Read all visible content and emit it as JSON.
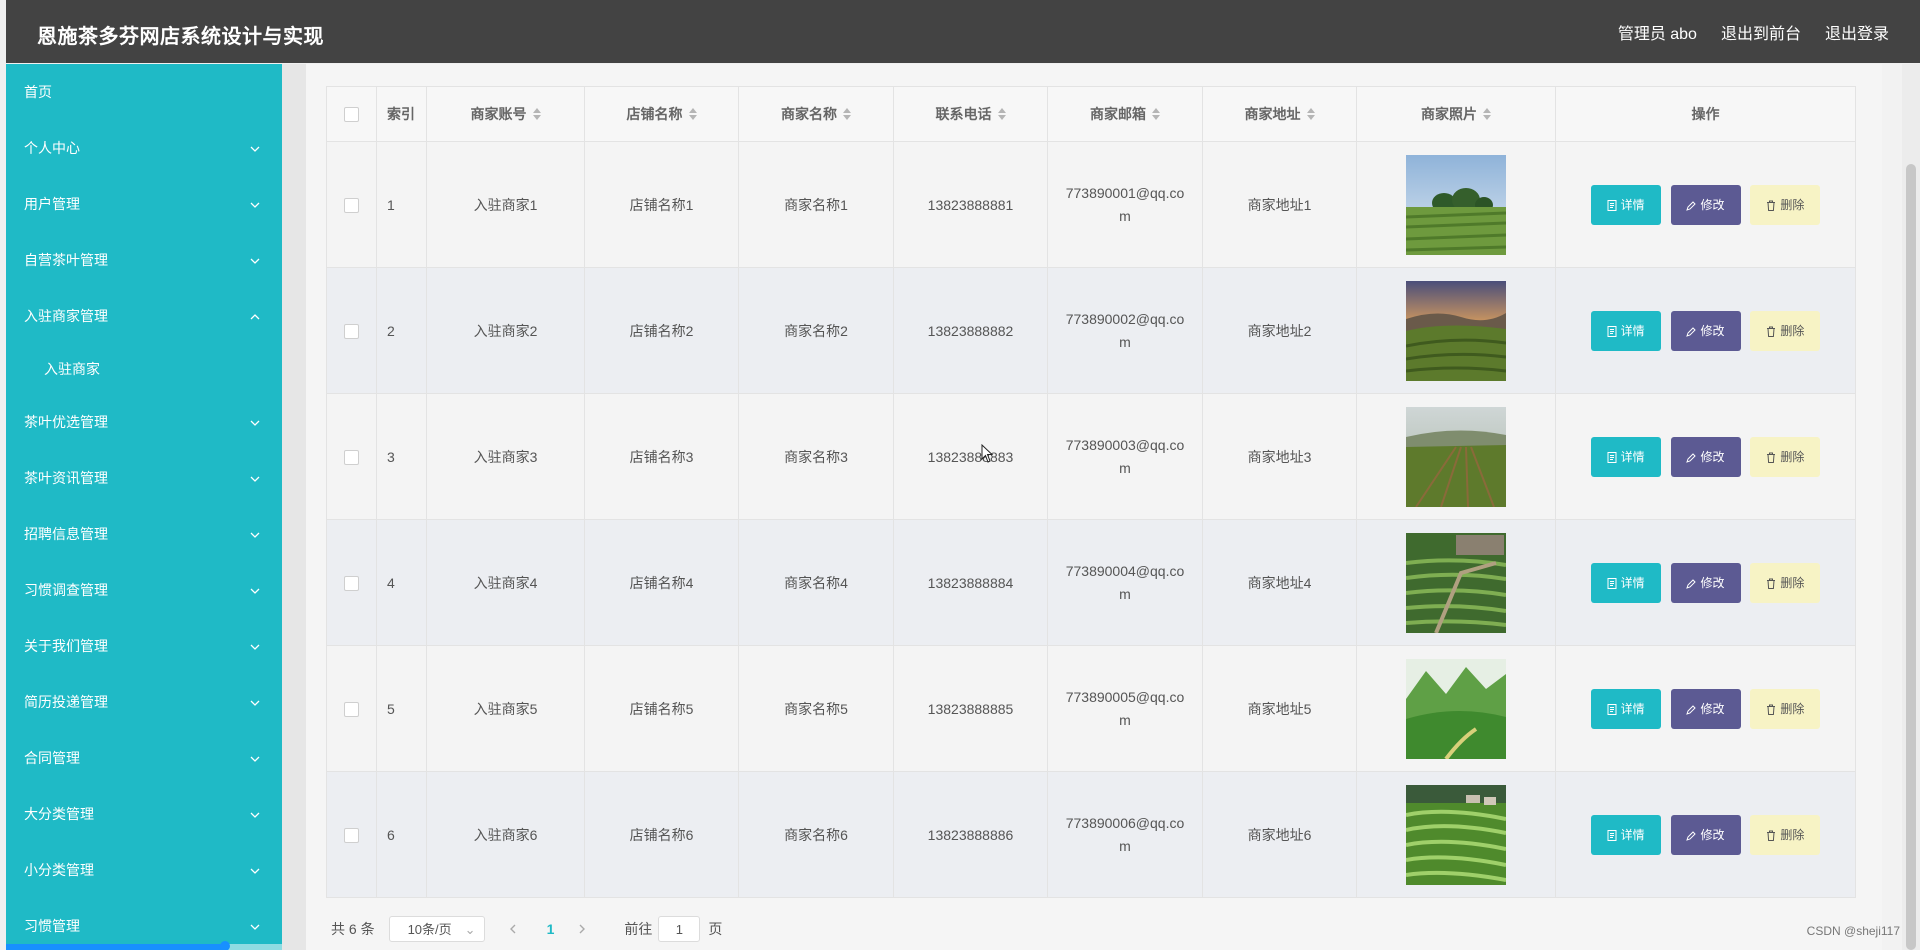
{
  "header": {
    "title": "恩施茶多芬网店系统设计与实现",
    "admin": "管理员 abo",
    "to_front": "退出到前台",
    "logout": "退出登录"
  },
  "sidebar": {
    "home": "首页",
    "items": [
      "个人中心",
      "用户管理",
      "自营茶叶管理",
      "入驻商家管理",
      "茶叶优选管理",
      "茶叶资讯管理",
      "招聘信息管理",
      "习惯调查管理",
      "关于我们管理",
      "简历投递管理",
      "合同管理",
      "大分类管理",
      "小分类管理",
      "习惯管理"
    ],
    "open_submenu": "入驻商家"
  },
  "table": {
    "headers": [
      "索引",
      "商家账号",
      "店铺名称",
      "商家名称",
      "联系电话",
      "商家邮箱",
      "商家地址",
      "商家照片",
      "操作"
    ],
    "rows": [
      {
        "index": "1",
        "account": "入驻商家1",
        "shop": "店铺名称1",
        "name": "商家名称1",
        "phone": "13823888881",
        "email1": "773890001@qq.co",
        "email2": "m",
        "address": "商家地址1"
      },
      {
        "index": "2",
        "account": "入驻商家2",
        "shop": "店铺名称2",
        "name": "商家名称2",
        "phone": "13823888882",
        "email1": "773890002@qq.co",
        "email2": "m",
        "address": "商家地址2"
      },
      {
        "index": "3",
        "account": "入驻商家3",
        "shop": "店铺名称3",
        "name": "商家名称3",
        "phone": "13823888883",
        "email1": "773890003@qq.co",
        "email2": "m",
        "address": "商家地址3"
      },
      {
        "index": "4",
        "account": "入驻商家4",
        "shop": "店铺名称4",
        "name": "商家名称4",
        "phone": "13823888884",
        "email1": "773890004@qq.co",
        "email2": "m",
        "address": "商家地址4"
      },
      {
        "index": "5",
        "account": "入驻商家5",
        "shop": "店铺名称5",
        "name": "商家名称5",
        "phone": "13823888885",
        "email1": "773890005@qq.co",
        "email2": "m",
        "address": "商家地址5"
      },
      {
        "index": "6",
        "account": "入驻商家6",
        "shop": "店铺名称6",
        "name": "商家名称6",
        "phone": "13823888886",
        "email1": "773890006@qq.co",
        "email2": "m",
        "address": "商家地址6"
      }
    ],
    "actions": {
      "detail": "详情",
      "edit": "修改",
      "delete": "删除"
    }
  },
  "pager": {
    "total": "共 6 条",
    "page_size": "10条/页",
    "current": "1",
    "goto_prefix": "前往",
    "goto_value": "1",
    "goto_suffix": "页"
  },
  "watermark": "CSDN @sheji117",
  "colors": {
    "header": "#434343",
    "sidebar": "#1fbac6",
    "detail_btn": "#1fbac6",
    "edit_btn": "#5c5a93",
    "delete_btn": "#f7f3c5"
  }
}
